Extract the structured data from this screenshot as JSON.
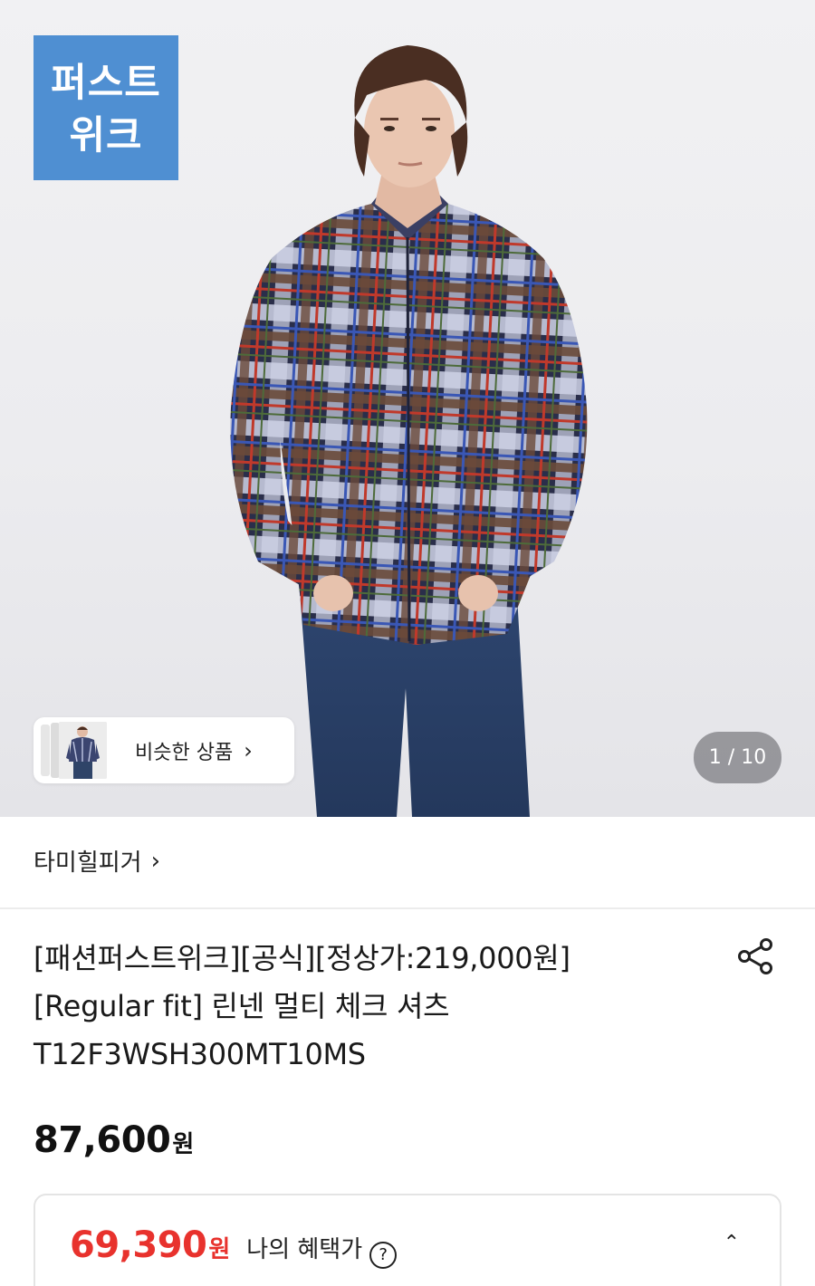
{
  "hero": {
    "badge_line1": "퍼스트",
    "badge_line2": "위크",
    "similar_label": "비슷한 상품",
    "similar_chevron": "›",
    "counter": "1 / 10"
  },
  "brand": {
    "name": "타미힐피거",
    "chevron": "›"
  },
  "product": {
    "title_line1": "[패션퍼스트위크][공식][정상가:219,000원]",
    "title_line2": "[Regular fit] 린넨 멀티 체크 셔츠",
    "title_line3": "T12F3WSH300MT10MS",
    "price": "87,600",
    "price_unit": "원"
  },
  "benefit": {
    "price": "69,390",
    "price_unit": "원",
    "label": "나의 혜택가",
    "help": "?",
    "toggle": "⌃"
  },
  "icons": {
    "share": "share-icon",
    "help": "question-icon",
    "chevron_up": "chevron-up-icon",
    "chevron_right": "chevron-right-icon"
  },
  "colors": {
    "badge": "#4f8fd2",
    "benefit_price": "#e8322d",
    "counter_bg": "#82828a"
  }
}
